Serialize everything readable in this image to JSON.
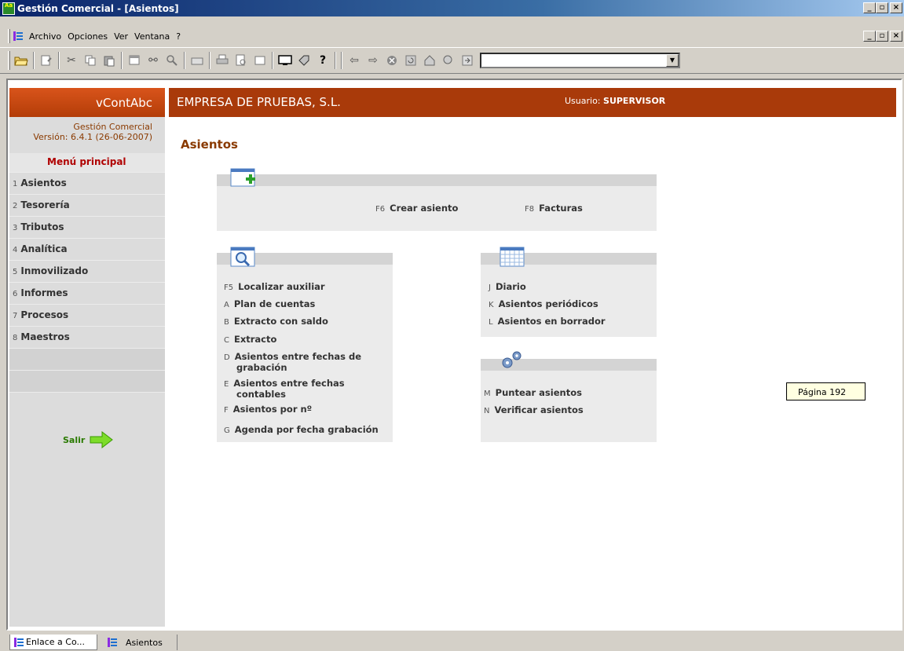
{
  "window": {
    "title": "Gestión Comercial - [Asientos]",
    "min": "_",
    "max": "▫",
    "close": "×"
  },
  "menu": {
    "items": [
      "Archivo",
      "Opciones",
      "Ver",
      "Ventana",
      "?"
    ]
  },
  "toolbar": {
    "combo_value": ""
  },
  "sidebar": {
    "brand": "vContAbc",
    "app_name": "Gestión Comercial",
    "version": "Versión: 6.4.1 (26-06-2007)",
    "menu_title": "Menú principal",
    "items": [
      {
        "num": "1",
        "label": "Asientos"
      },
      {
        "num": "2",
        "label": "Tesorería"
      },
      {
        "num": "3",
        "label": "Tributos"
      },
      {
        "num": "4",
        "label": "Analítica"
      },
      {
        "num": "5",
        "label": "Inmovilizado"
      },
      {
        "num": "6",
        "label": "Informes"
      },
      {
        "num": "7",
        "label": "Procesos"
      },
      {
        "num": "8",
        "label": "Maestros"
      }
    ],
    "exit_label": "Salir"
  },
  "header": {
    "company": "EMPRESA DE PRUEBAS, S.L.",
    "user_label": "Usuario:",
    "user_name": "SUPERVISOR"
  },
  "page_title": "Asientos",
  "panels": {
    "create": [
      {
        "key": "F6",
        "label": "Crear asiento"
      },
      {
        "key": "F8",
        "label": "Facturas"
      }
    ],
    "search": [
      {
        "key": "F5",
        "label": "Localizar auxiliar"
      },
      {
        "key": "A",
        "label": "Plan de cuentas"
      },
      {
        "key": "B",
        "label": "Extracto con saldo"
      },
      {
        "key": "C",
        "label": "Extracto"
      },
      {
        "key": "D",
        "label": "Asientos entre fechas de",
        "label2": "grabación"
      },
      {
        "key": "E",
        "label": "Asientos entre fechas",
        "label2": "contables"
      },
      {
        "key": "F",
        "label": "Asientos por nº"
      },
      {
        "key": "G",
        "label": "Agenda por fecha grabación"
      }
    ],
    "calendar": [
      {
        "key": "J",
        "label": "Diario"
      },
      {
        "key": "K",
        "label": "Asientos periódicos"
      },
      {
        "key": "L",
        "label": "Asientos en borrador"
      }
    ],
    "tools": [
      {
        "key": "M",
        "label": "Puntear asientos"
      },
      {
        "key": "N",
        "label": "Verificar asientos"
      }
    ]
  },
  "tooltip": "Página 192",
  "tabs": [
    "Enlace a Co...",
    "Asientos"
  ]
}
